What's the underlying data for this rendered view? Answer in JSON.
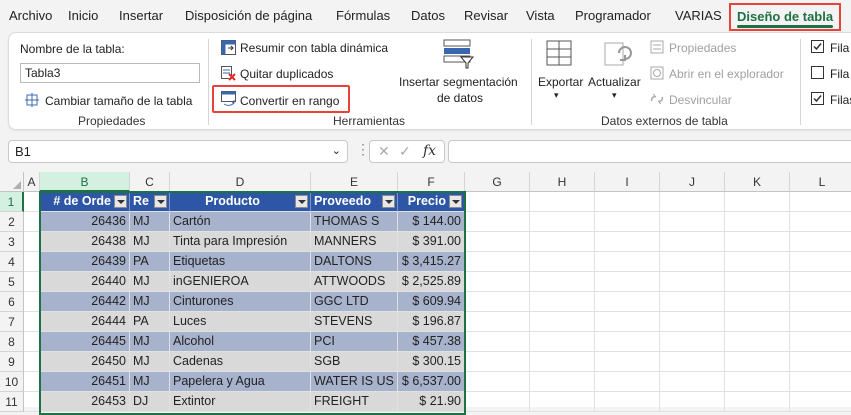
{
  "menu": {
    "items": [
      "Archivo",
      "Inicio",
      "Insertar",
      "Disposición de página",
      "Fórmulas",
      "Datos",
      "Revisar",
      "Vista",
      "Programador",
      "VARIAS"
    ],
    "active": "Diseño de tabla"
  },
  "ribbon": {
    "propiedades": {
      "name_label": "Nombre de la tabla:",
      "name_value": "Tabla3",
      "resize": "Cambiar tamaño de la tabla",
      "group": "Propiedades"
    },
    "herramientas": {
      "pivot": "Resumir con tabla dinámica",
      "dupes": "Quitar duplicados",
      "convert": "Convertir en rango",
      "slicer_line1": "Insertar segmentación",
      "slicer_line2": "de datos",
      "group": "Herramientas"
    },
    "externos": {
      "export": "Exportar",
      "refresh": "Actualizar",
      "props": "Propiedades",
      "browser": "Abrir en el explorador",
      "unlink": "Desvincular",
      "group": "Datos externos de tabla"
    },
    "estilos": {
      "opt1": "Fila d",
      "opt2": "Fila d",
      "opt3": "Filas"
    }
  },
  "formula_bar": {
    "cell_ref": "B1",
    "fx": "fx",
    "value": ""
  },
  "sheet": {
    "columns": [
      "A",
      "B",
      "C",
      "D",
      "E",
      "F",
      "G",
      "H",
      "I",
      "J",
      "K",
      "L"
    ],
    "rows": [
      "1",
      "2",
      "3",
      "4",
      "5",
      "6",
      "7",
      "8",
      "9",
      "10",
      "11"
    ],
    "table": {
      "headers": [
        "# de Orde",
        "Re",
        "Producto",
        "Proveedo",
        "Precio"
      ],
      "rows": [
        [
          "26436",
          "MJ",
          "Cartón",
          "THOMAS S",
          "$ 144.00"
        ],
        [
          "26438",
          "MJ",
          "Tinta para Impresión",
          "MANNERS",
          "$ 391.00"
        ],
        [
          "26439",
          "PA",
          "Etiquetas",
          "DALTONS",
          "$ 3,415.27"
        ],
        [
          "26440",
          "MJ",
          "inGENIEROA",
          "ATTWOODS",
          "$ 2,525.89"
        ],
        [
          "26442",
          "MJ",
          "Cinturones",
          "GGC LTD",
          "$ 609.94"
        ],
        [
          "26444",
          "PA",
          "Luces",
          "STEVENS",
          "$ 196.87"
        ],
        [
          "26445",
          "MJ",
          "Alcohol",
          "PCI",
          "$ 457.38"
        ],
        [
          "26450",
          "MJ",
          "Cadenas",
          "SGB",
          "$ 300.15"
        ],
        [
          "26451",
          "MJ",
          "Papelera y Agua",
          "WATER IS US",
          "$ 6,537.00"
        ],
        [
          "26453",
          "DJ",
          "Extintor",
          "FREIGHT",
          "$ 21.90"
        ]
      ]
    }
  },
  "colors": {
    "accent": "#1e7145",
    "highlight": "#e8423b",
    "table_header": "#2e56a6",
    "band_dark": "#a7b2cc",
    "band_light": "#d9d9d9"
  }
}
